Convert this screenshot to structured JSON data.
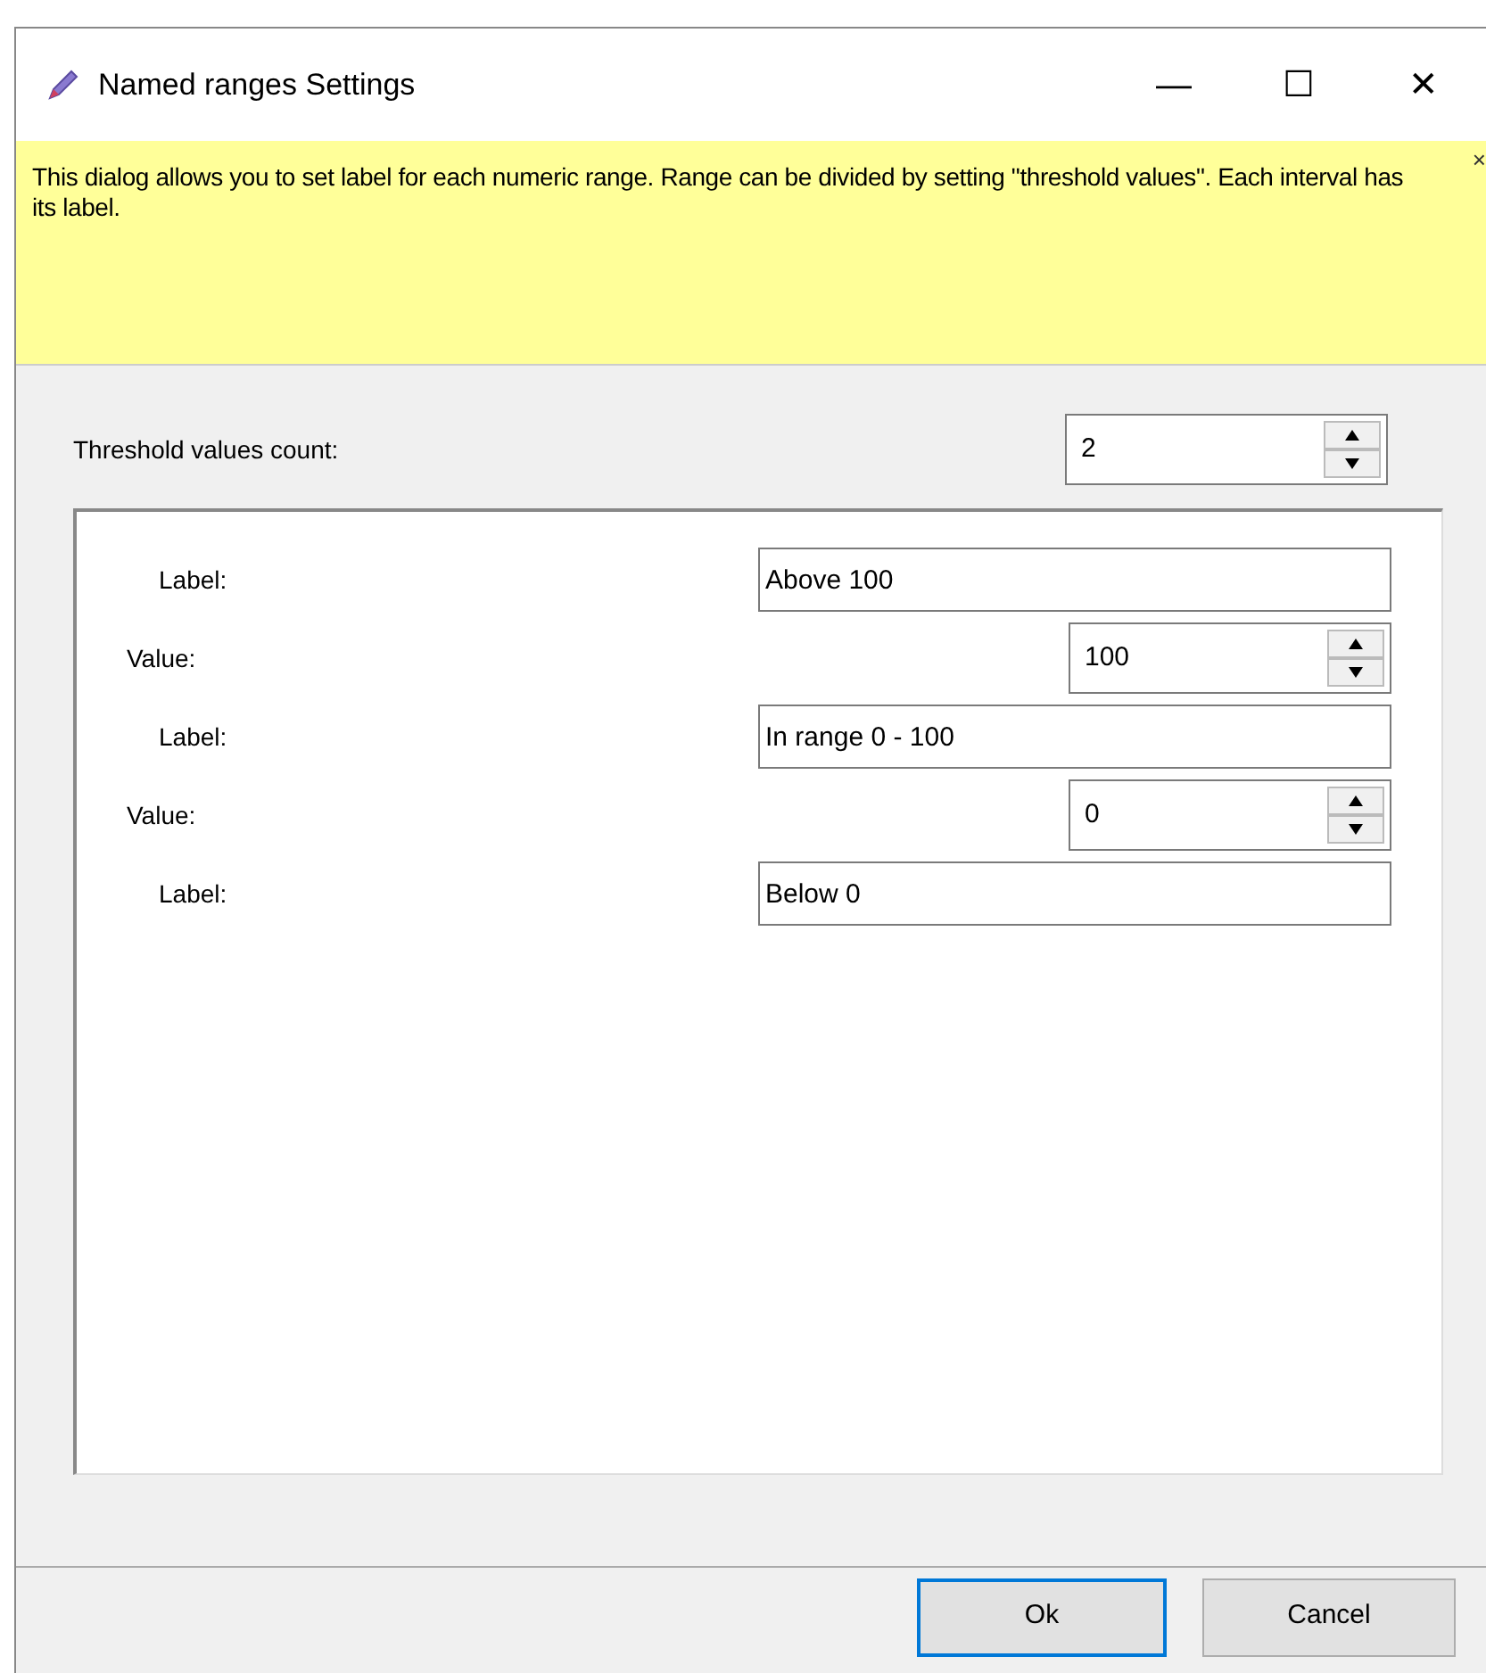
{
  "window": {
    "title": "Named ranges Settings",
    "controls": [
      "—",
      "☐",
      "✕"
    ]
  },
  "banner": {
    "text": "This dialog allows you to set label for each numeric range. Range can be divided by setting \"threshold values\". Each interval has its label.",
    "close": "×"
  },
  "threshold": {
    "label": "Threshold values count:",
    "value": "2"
  },
  "rows": [
    {
      "kind": "label",
      "label": "Label:",
      "value": "Above 100"
    },
    {
      "kind": "value",
      "label": "Value:",
      "value": "100"
    },
    {
      "kind": "label",
      "label": "Label:",
      "value": "In range 0 - 100"
    },
    {
      "kind": "value",
      "label": "Value:",
      "value": "0"
    },
    {
      "kind": "label",
      "label": "Label:",
      "value": "Below 0"
    }
  ],
  "buttons": [
    {
      "label": "Ok",
      "default": true
    },
    {
      "label": "Cancel",
      "default": false
    }
  ]
}
